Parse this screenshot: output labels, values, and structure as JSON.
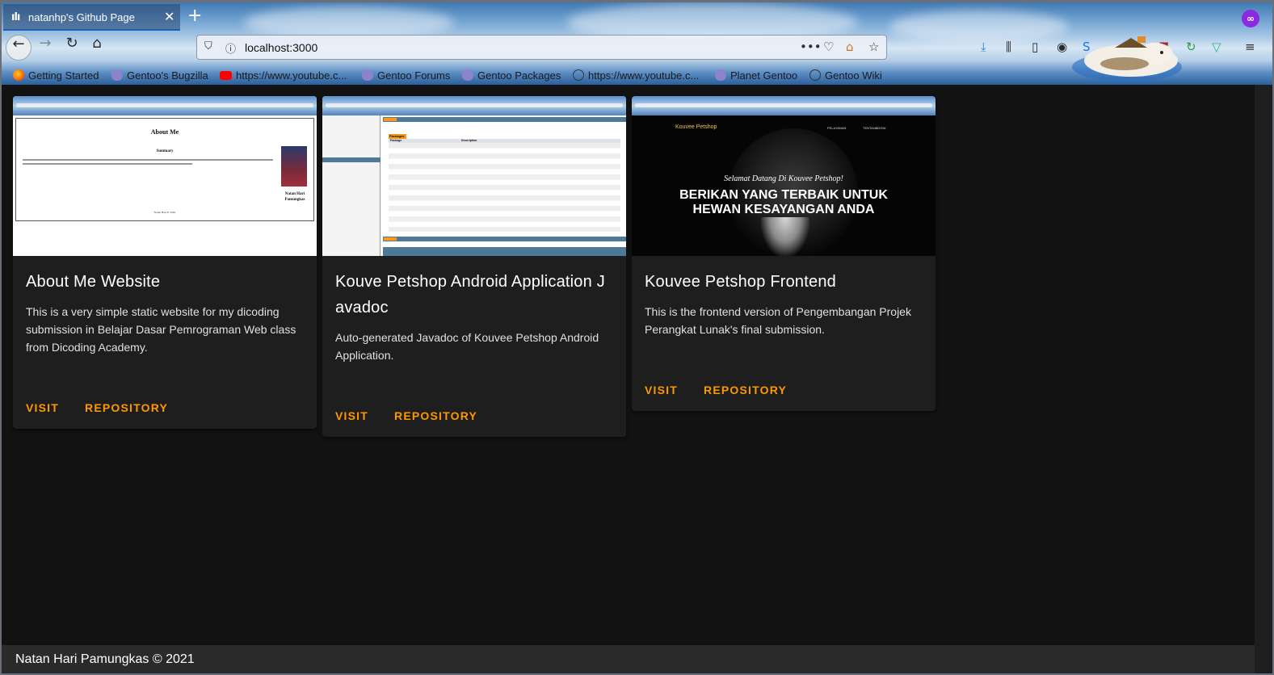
{
  "browser": {
    "tab_title": "natanhp's Github Page",
    "tab_icon": "ılı",
    "tab_close": "✕",
    "new_tab": "+",
    "url": "localhost:3000",
    "bookmarks": [
      {
        "icon": "firefox-icon",
        "label": "Getting Started"
      },
      {
        "icon": "gentoo-icon",
        "label": "Gentoo's Bugzilla"
      },
      {
        "icon": "youtube-icon",
        "label": "https://www.youtube.c..."
      },
      {
        "icon": "gentoo-icon",
        "label": "Gentoo Forums"
      },
      {
        "icon": "gentoo-icon",
        "label": "Gentoo Packages"
      },
      {
        "icon": "globe-icon",
        "label": "https://www.youtube.c..."
      },
      {
        "icon": "gentoo-icon",
        "label": "Planet Gentoo"
      },
      {
        "icon": "globe-icon",
        "label": "Gentoo Wiki"
      }
    ]
  },
  "cards": [
    {
      "title": "About Me Website",
      "description": "This is a very simple static website for my dicoding submission in Belajar Dasar Pemrograman Web class from Dicoding Academy.",
      "visit": "VISIT",
      "repository": "REPOSITORY",
      "thumb": {
        "heading": "About Me",
        "subheading": "Summary",
        "name": "Natan Hari Pamungkas",
        "footer": "Natan Hari P. 2020"
      }
    },
    {
      "title": "Kouve Petshop Android Application Javadoc",
      "description": "Auto-generated Javadoc of Kouvee Petshop Android Application.",
      "visit": "VISIT",
      "repository": "REPOSITORY",
      "thumb": {
        "heading": "Packages",
        "column_package": "Package",
        "column_description": "Description"
      }
    },
    {
      "title": "Kouvee Petshop Frontend",
      "description": "This is the frontend version of Pengembangan Projek Perangkat Lunak's final submission.",
      "visit": "VISIT",
      "repository": "REPOSITORY",
      "thumb": {
        "brand": "Kouvee Petshop",
        "nav": [
          "PELAYANAN",
          "TENTANG",
          "LOGIN"
        ],
        "welcome": "Selamat Datang Di Kouvee Petshop!",
        "headline": "BERIKAN YANG TERBAIK UNTUK HEWAN KESAYANGAN ANDA"
      }
    }
  ],
  "footer": "Natan Hari Pamungkas © 2021",
  "colors": {
    "accent": "#ff9800",
    "card_bg": "#1e1e1e",
    "page_bg": "#121212"
  }
}
